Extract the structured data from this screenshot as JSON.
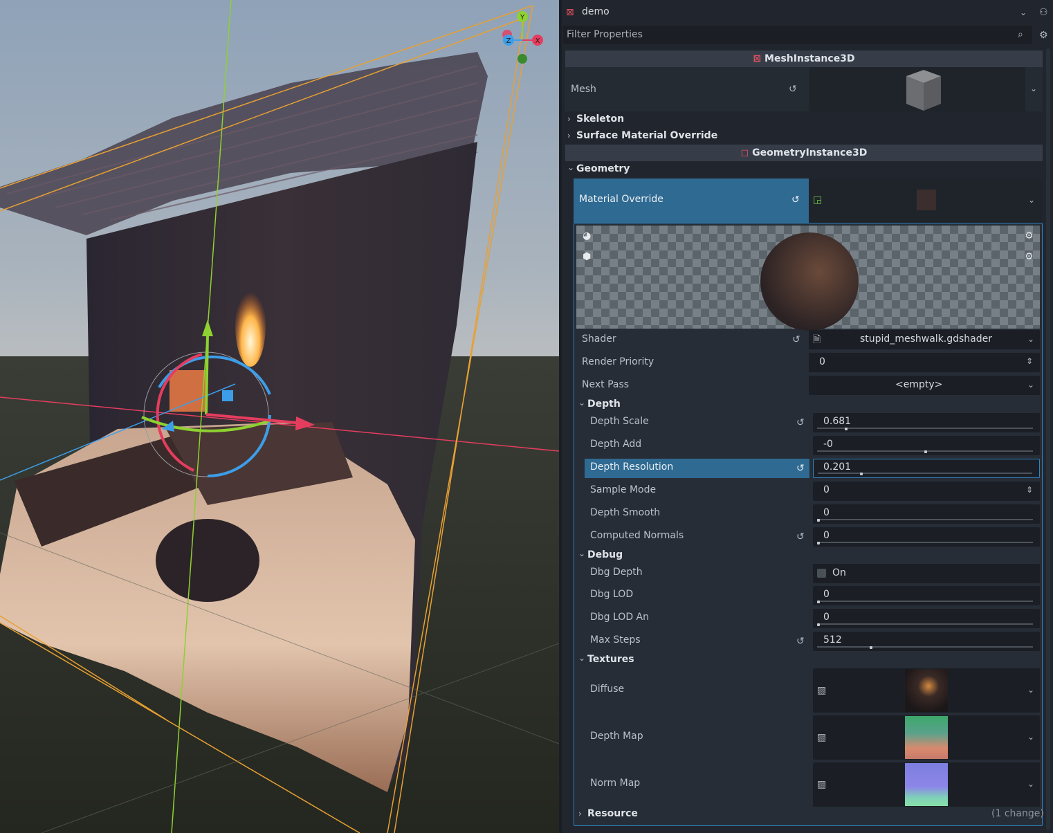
{
  "scene_name": "demo",
  "filter_placeholder": "Filter Properties",
  "gizmo": {
    "y": "Y",
    "x": "X",
    "z": "Z"
  },
  "categories": {
    "mesh_instance": "MeshInstance3D",
    "geometry_instance": "GeometryInstance3D"
  },
  "mesh": {
    "label": "Mesh"
  },
  "sections": {
    "skeleton": "Skeleton",
    "surface_material_override": "Surface Material Override",
    "geometry": "Geometry",
    "depth": "Depth",
    "debug": "Debug",
    "textures": "Textures",
    "resource": "Resource",
    "resource_changes": "(1 change)"
  },
  "material_override": {
    "label": "Material Override"
  },
  "shader": {
    "label": "Shader",
    "value": "stupid_meshwalk.gdshader"
  },
  "render_priority": {
    "label": "Render Priority",
    "value": "0"
  },
  "next_pass": {
    "label": "Next Pass",
    "value": "<empty>"
  },
  "depth": {
    "depth_scale": {
      "label": "Depth Scale",
      "value": "0.681",
      "level": 0.14
    },
    "depth_add": {
      "label": "Depth Add",
      "value": "-0",
      "level": 0.5
    },
    "depth_resolution": {
      "label": "Depth Resolution",
      "value": "0.201",
      "level": 0.2
    },
    "sample_mode": {
      "label": "Sample Mode",
      "value": "0"
    },
    "depth_smooth": {
      "label": "Depth Smooth",
      "value": "0",
      "level": 0
    },
    "computed_normals": {
      "label": "Computed Normals",
      "value": "0",
      "level": 0
    }
  },
  "debug": {
    "dbg_depth": {
      "label": "Dbg Depth",
      "value": "On",
      "checked": false
    },
    "dbg_lod": {
      "label": "Dbg LOD",
      "value": "0",
      "level": 0
    },
    "dbg_lod_an": {
      "label": "Dbg LOD An",
      "value": "0",
      "level": 0
    },
    "max_steps": {
      "label": "Max Steps",
      "value": "512",
      "level": 0.25
    }
  },
  "textures": {
    "diffuse": {
      "label": "Diffuse"
    },
    "depth_map": {
      "label": "Depth Map"
    },
    "norm_map": {
      "label": "Norm Map"
    }
  },
  "colors": {
    "accent": "#2f83c1",
    "selected_row": "#2f6a92",
    "axis_x": "#e53d5e",
    "axis_y": "#8ed130",
    "axis_z": "#3c9ee8",
    "bbox": "#e8a033"
  }
}
